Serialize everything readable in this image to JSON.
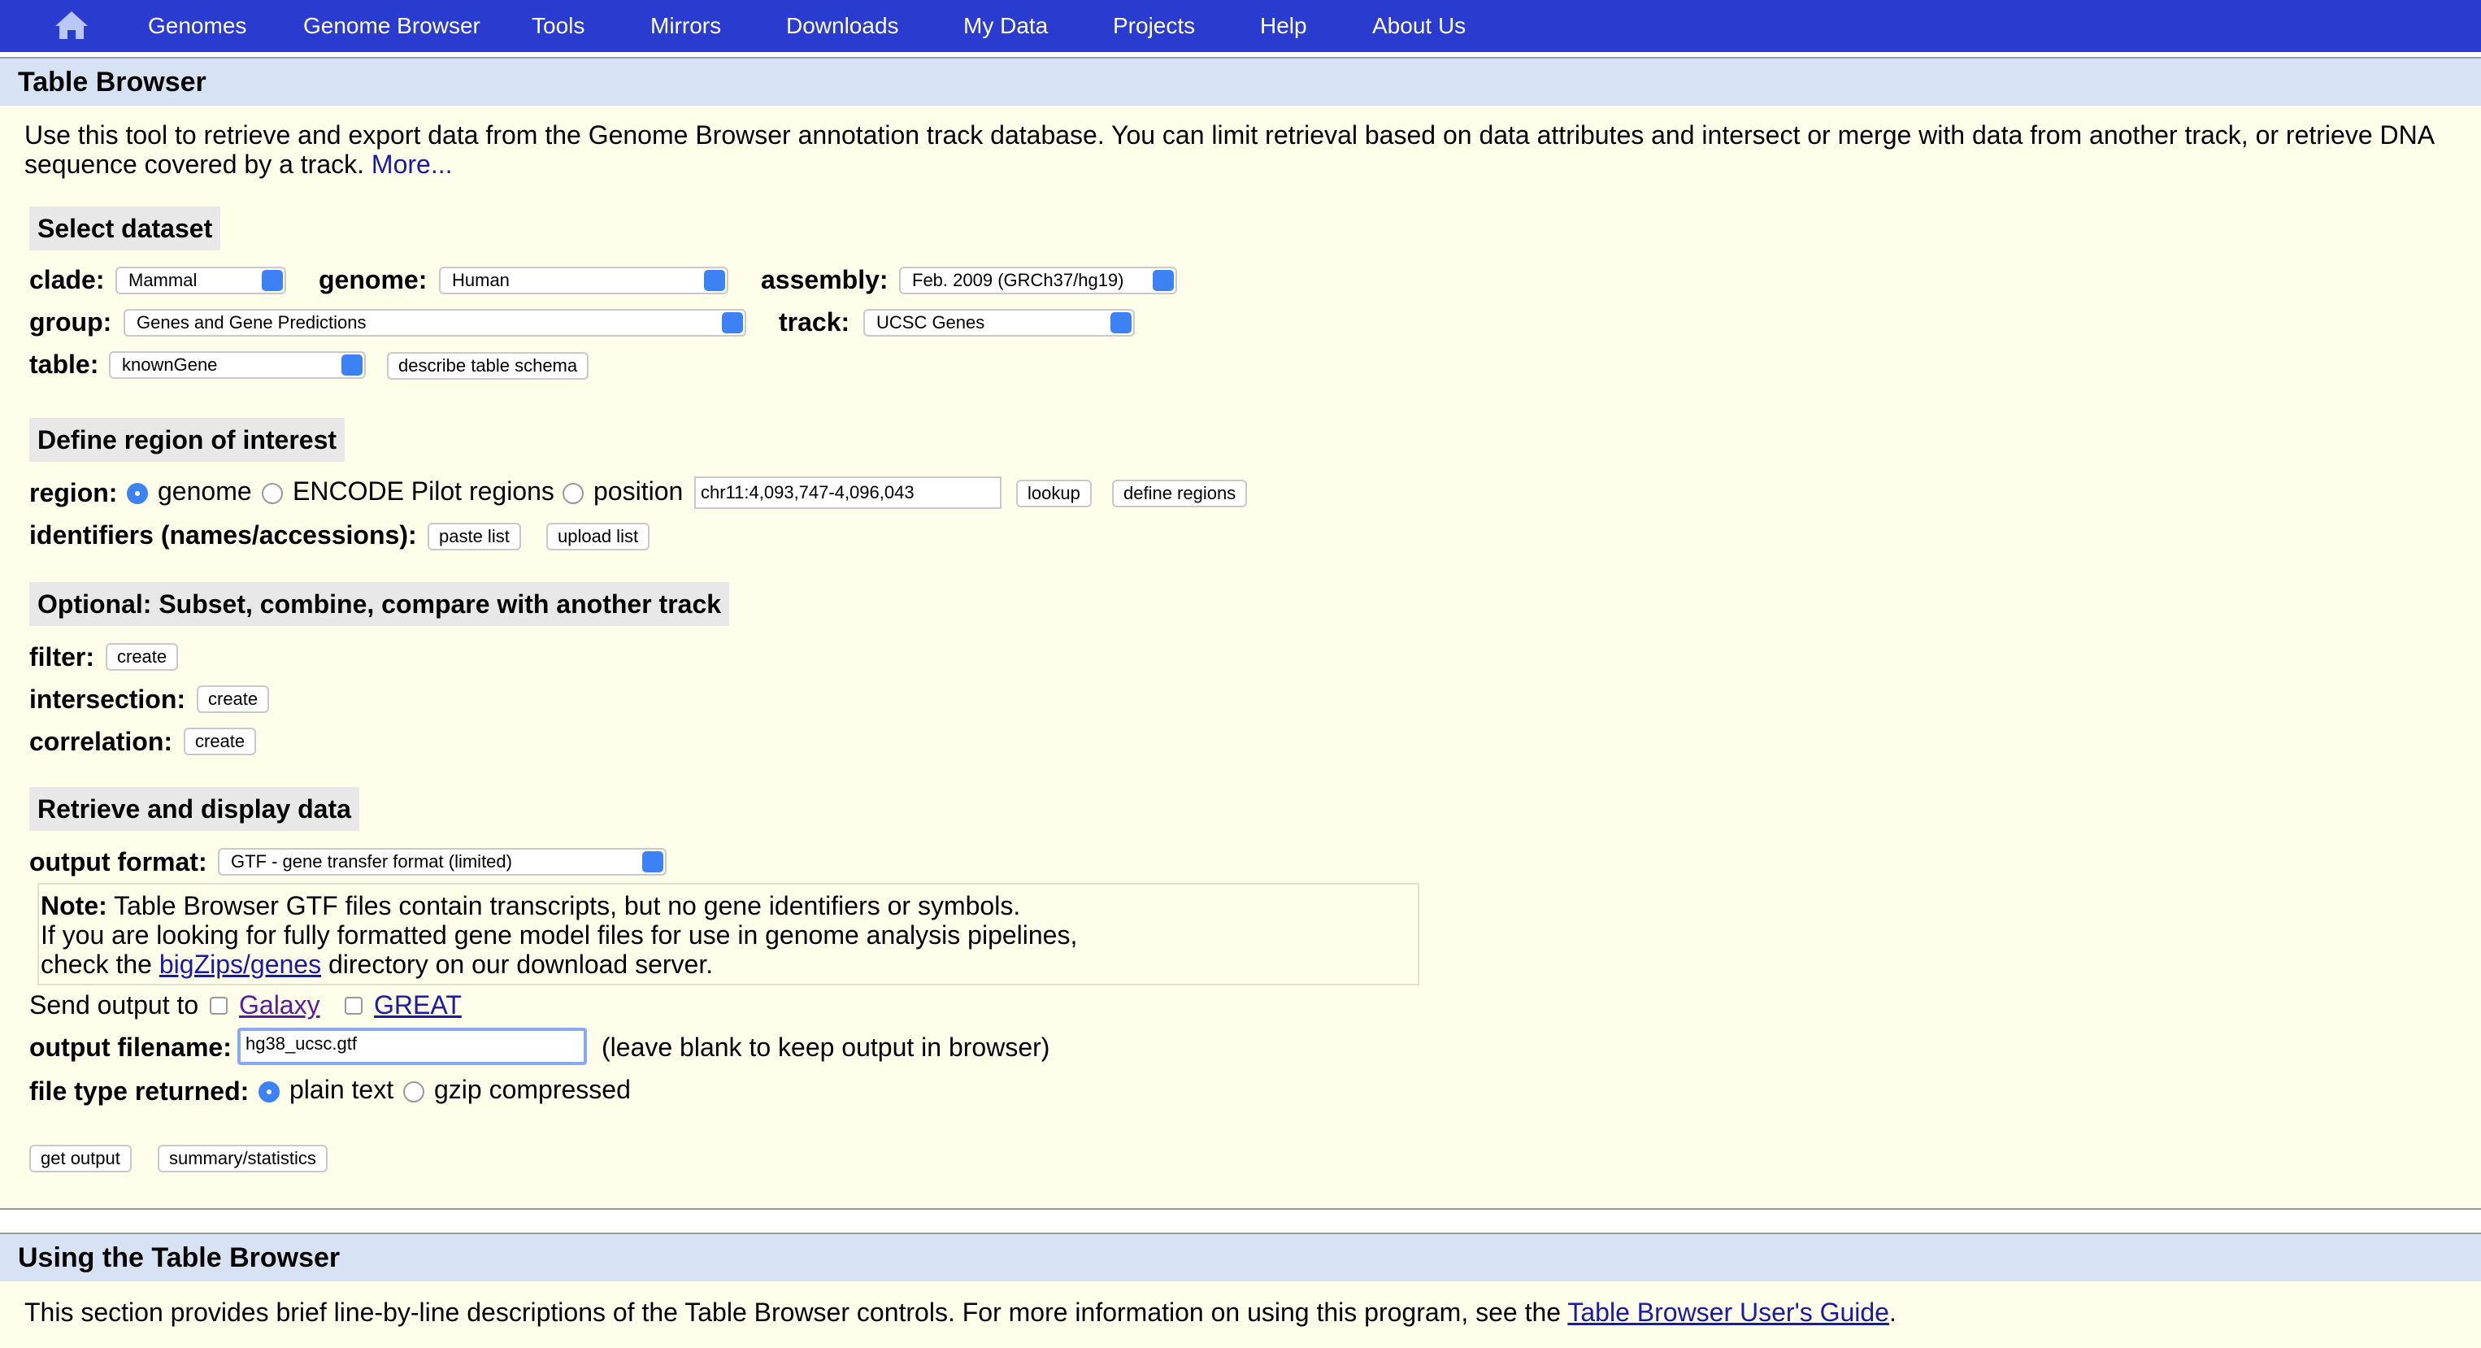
{
  "nav": {
    "home_icon": "home-icon",
    "items": [
      "Genomes",
      "Genome Browser",
      "Tools",
      "Mirrors",
      "Downloads",
      "My Data",
      "Projects",
      "Help",
      "About Us"
    ]
  },
  "main_panel": {
    "title": "Table Browser",
    "intro": "Use this tool to retrieve and export data from the Genome Browser annotation track database. You can limit retrieval based on data attributes and intersect or merge with data from another track, or retrieve DNA",
    "intro_line2": "sequence covered by a track.",
    "more_link": "More...",
    "select_dataset": {
      "title": "Select dataset",
      "clade_label": "clade:",
      "clade_value": "Mammal",
      "genome_label": "genome:",
      "genome_value": "Human",
      "assembly_label": "assembly:",
      "assembly_value": "Feb. 2009 (GRCh37/hg19)",
      "group_label": "group:",
      "group_value": "Genes and Gene Predictions",
      "track_label": "track:",
      "track_value": "UCSC Genes",
      "table_label": "table:",
      "table_value": "knownGene",
      "describe_button": "describe table schema"
    },
    "define_region": {
      "title": "Define region of interest",
      "region_label": "region:",
      "opt_genome": "genome",
      "opt_encode": "ENCODE Pilot regions",
      "opt_position": "position",
      "position_value": "chr11:4,093,747-4,096,043",
      "lookup_button": "lookup",
      "define_regions_button": "define regions",
      "identifiers_label": "identifiers (names/accessions):",
      "paste_list_button": "paste list",
      "upload_list_button": "upload list"
    },
    "optional": {
      "title": "Optional: Subset, combine, compare with another track",
      "filter_label": "filter:",
      "intersection_label": "intersection:",
      "correlation_label": "correlation:",
      "create_button": "create"
    },
    "retrieve": {
      "title": "Retrieve and display data",
      "output_format_label": "output format:",
      "output_format_value": "GTF - gene transfer format (limited)",
      "note_bold": "Note:",
      "note_line1": " Table Browser GTF files contain transcripts, but no gene identifiers or symbols.",
      "note_line2": "If you are looking for fully formatted gene model files for use in genome analysis pipelines,",
      "note_line3_pre": "check the ",
      "note_link": "bigZips/genes",
      "note_line3_post": " directory on our download server.",
      "send_output_label": "Send output to",
      "galaxy": "Galaxy",
      "great": "GREAT",
      "output_filename_label": "output filename:",
      "output_filename_value": "hg38_ucsc.gtf",
      "filename_hint": "(leave blank to keep output in browser)",
      "file_type_label": "file type returned:",
      "opt_plain": "plain text",
      "opt_gzip": "gzip compressed",
      "get_output_button": "get output",
      "summary_button": "summary/statistics"
    }
  },
  "using_panel": {
    "title": "Using the Table Browser",
    "text": "This section provides brief line-by-line descriptions of the Table Browser controls. For more information on using this program, see the",
    "link": "Table Browser User's Guide",
    "text_end": "."
  },
  "colors": {
    "nav_bg": "#2a3bcf",
    "panel_bg": "#fffeea",
    "header_bg": "#d8e2f5",
    "accent": "#3d82f5",
    "link": "#1a1aa8"
  }
}
